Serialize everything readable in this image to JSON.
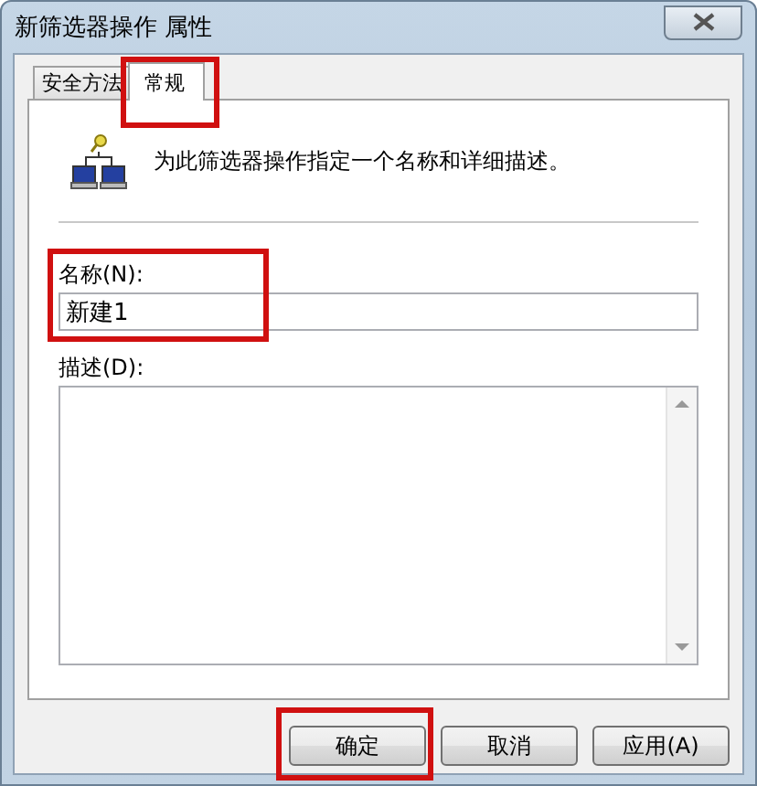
{
  "window": {
    "title": "新筛选器操作 属性"
  },
  "tabs": [
    {
      "label": "安全方法",
      "selected": false,
      "highlighted": false
    },
    {
      "label": "常规",
      "selected": true,
      "highlighted": true
    }
  ],
  "intro": "为此筛选器操作指定一个名称和详细描述。",
  "name_field": {
    "label": "名称(N):",
    "value": "新建1",
    "highlighted": true
  },
  "description_field": {
    "label": "描述(D):"
  },
  "buttons": [
    {
      "label": "确定",
      "highlighted": true
    },
    {
      "label": "取消",
      "highlighted": false
    },
    {
      "label": "应用(A)",
      "highlighted": false
    }
  ]
}
